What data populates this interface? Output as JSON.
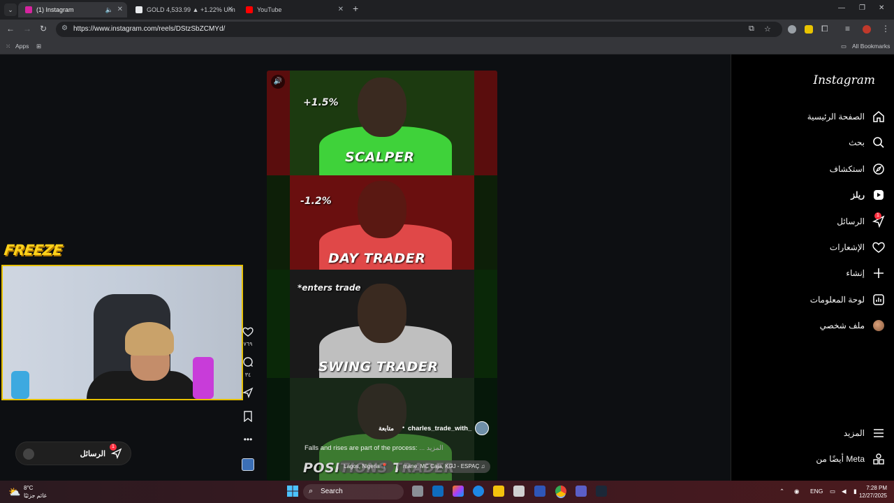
{
  "browser": {
    "tabs": [
      {
        "label": "(1) Instagram",
        "active": true,
        "favicon_color": "#d6249f"
      },
      {
        "label": "GOLD 4,533.99 ▲ +1.22% Unn",
        "active": false,
        "favicon_color": "#e8eaed"
      },
      {
        "label": "YouTube",
        "active": false,
        "favicon_color": "#ff0000"
      }
    ],
    "url": "https://www.instagram.com/reels/DStzSbZCMYd/",
    "bookmarks": {
      "apps": "Apps",
      "all": "All Bookmarks"
    }
  },
  "instagram": {
    "logo": "Instagram",
    "nav": [
      {
        "label": "الصفحة الرئيسية",
        "icon": "home-icon"
      },
      {
        "label": "بحث",
        "icon": "search-icon"
      },
      {
        "label": "استكشاف",
        "icon": "compass-icon"
      },
      {
        "label": "ريلز",
        "icon": "reels-icon",
        "active": true
      },
      {
        "label": "الرسائل",
        "icon": "messenger-icon",
        "badge": "1"
      },
      {
        "label": "الإشعارات",
        "icon": "heart-icon"
      },
      {
        "label": "إنشاء",
        "icon": "plus-icon"
      },
      {
        "label": "لوحة المعلومات",
        "icon": "dashboard-icon"
      },
      {
        "label": "ملف شخصي",
        "icon": "profile-avatar"
      }
    ],
    "more": "المزيد",
    "meta": "أيضًا من Meta"
  },
  "reel": {
    "panels": [
      {
        "pct": "+1.5%",
        "caption": "SCALPER"
      },
      {
        "pct": "-1.2%",
        "caption": "DAY TRADER"
      },
      {
        "pct": "*enters trade",
        "caption": "SWING TRADER"
      },
      {
        "pct": "",
        "caption": "POSITIONS TRADER"
      }
    ],
    "author": "charles_trade_with_",
    "follow": "متابعة",
    "separator": "•",
    "caption": "Falls and rises are part of the process:",
    "more": "... المزيد",
    "location": "Lagos, Nigeria",
    "audio": "mane, MC Caja, KGJ - ESPAÇ",
    "likes": "٧٦٩",
    "comments": "٣٤"
  },
  "overlay": {
    "brand": "FREEZE",
    "messages_label": "الرسائل",
    "messages_badge": "1"
  },
  "taskbar": {
    "temp": "8°C",
    "weather_text": "غائم جزئيًا",
    "search": "Search",
    "lang": "ENG",
    "time": "7:28 PM",
    "date": "12/27/2025"
  }
}
